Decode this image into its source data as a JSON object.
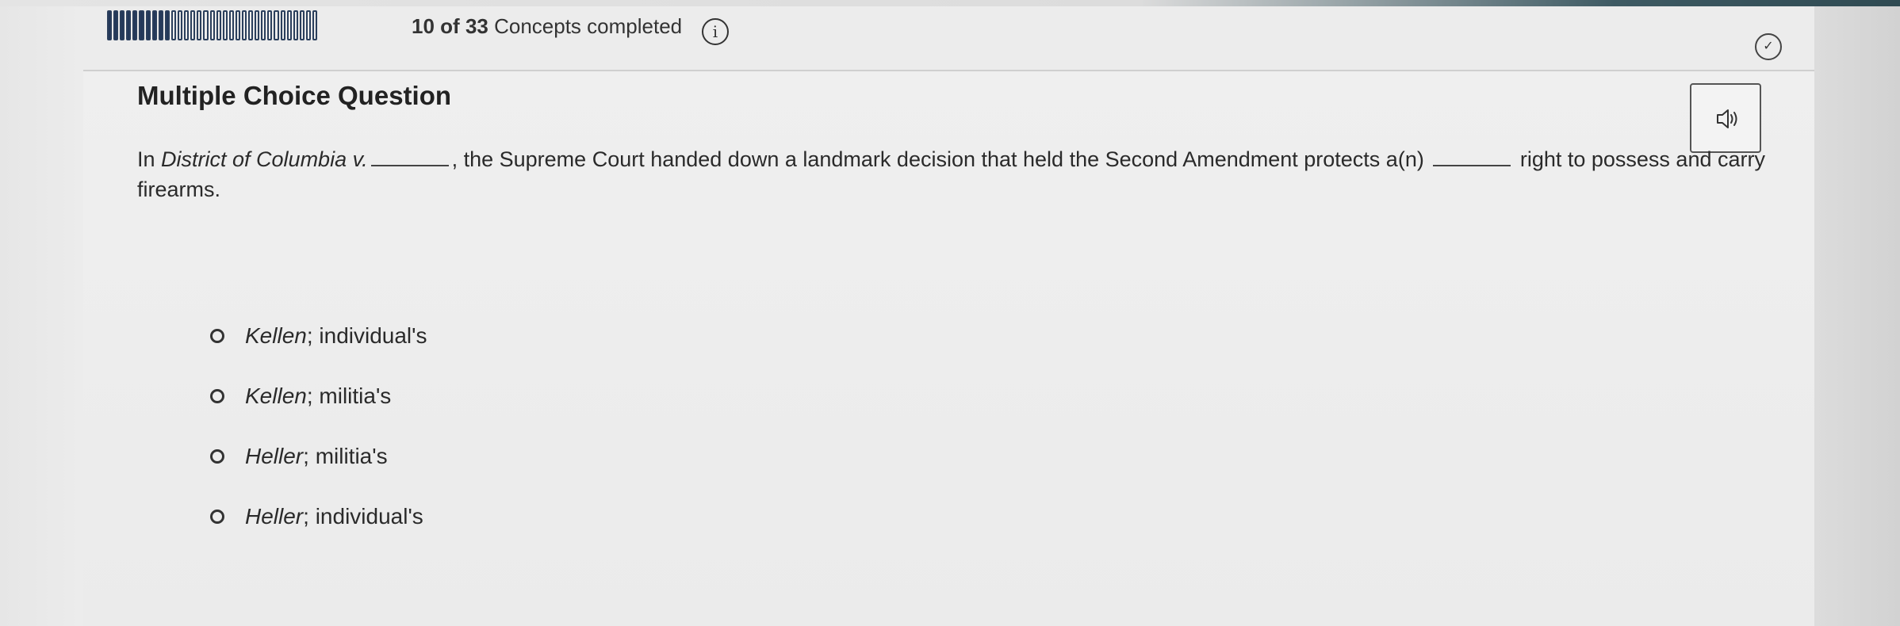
{
  "progress": {
    "completed": 10,
    "total": 33,
    "prefix_count": "10",
    "of_label": "of",
    "total_count": "33",
    "suffix_label": "Concepts completed",
    "done_color": "#23385a"
  },
  "header": {
    "info_icon": "info-icon",
    "info_glyph": "i",
    "check_icon": "check-circle-icon",
    "check_glyph": "✓"
  },
  "question": {
    "type_label": "Multiple Choice Question",
    "audio_icon": "speaker-icon",
    "prompt": {
      "part1": "In ",
      "case_name": "District of Columbia v.",
      "part2": ", the Supreme Court handed down a landmark decision that held the Second Amendment protects a(n) ",
      "part3": " right to possess and carry firearms."
    },
    "options": [
      {
        "case": "Kellen",
        "rest": "; individual's"
      },
      {
        "case": "Kellen",
        "rest": "; militia's"
      },
      {
        "case": "Heller",
        "rest": "; militia's"
      },
      {
        "case": "Heller",
        "rest": "; individual's"
      }
    ]
  }
}
